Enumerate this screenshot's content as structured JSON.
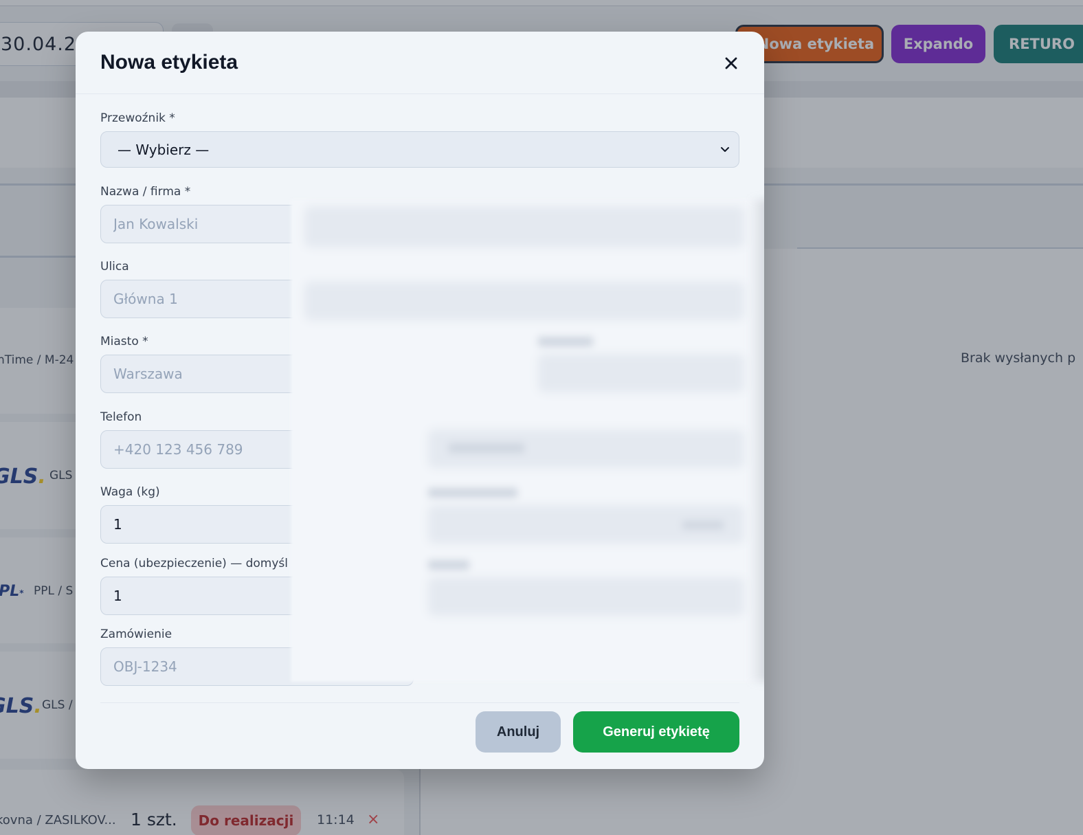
{
  "header": {
    "date_value": "30.04.20",
    "buttons": {
      "new_label": "Nowa etykieta",
      "expando": "Expando",
      "returo": "RETURO"
    }
  },
  "background_rows": [
    {
      "carrier_text": "nTime / M-24"
    },
    {
      "logo": "GLS",
      "carrier_text": "GLS"
    },
    {
      "logo": "PPL",
      "carrier_text": "PPL / S"
    },
    {
      "logo": "GLS",
      "carrier_text": "GLS /"
    }
  ],
  "bottom_row": {
    "name": "kovna / ZASILKOV...",
    "qty": "1 szt.",
    "status": "Do realizacji",
    "time": "11:14",
    "delete_icon": "×"
  },
  "right_panel": {
    "empty_message": "Brak wysłanych p"
  },
  "modal": {
    "title": "Nowa etykieta",
    "close_icon": "×",
    "fields": {
      "carrier": {
        "label": "Przewoźnik *",
        "selected": "— Wybierz —"
      },
      "name": {
        "label": "Nazwa / firma *",
        "placeholder": "Jan Kowalski"
      },
      "street": {
        "label": "Ulica",
        "placeholder": "Główna 1"
      },
      "city": {
        "label": "Miasto *",
        "placeholder": "Warszawa"
      },
      "phone": {
        "label": "Telefon",
        "placeholder": "+420 123 456 789"
      },
      "weight": {
        "label": "Waga (kg)",
        "value": "1"
      },
      "price": {
        "label": "Cena (ubezpieczenie) — domyśl",
        "value": "1"
      },
      "order": {
        "label": "Zamówienie",
        "placeholder": "OBJ-1234"
      }
    },
    "buttons": {
      "cancel": "Anuluj",
      "generate": "Generuj etykietę"
    }
  },
  "colors": {
    "accent_orange": "#ea580c",
    "expando_purple": "#7e22ce",
    "returo_teal": "#0f766e",
    "generate_green": "#16a34a",
    "status_red": "#b91c1c"
  }
}
